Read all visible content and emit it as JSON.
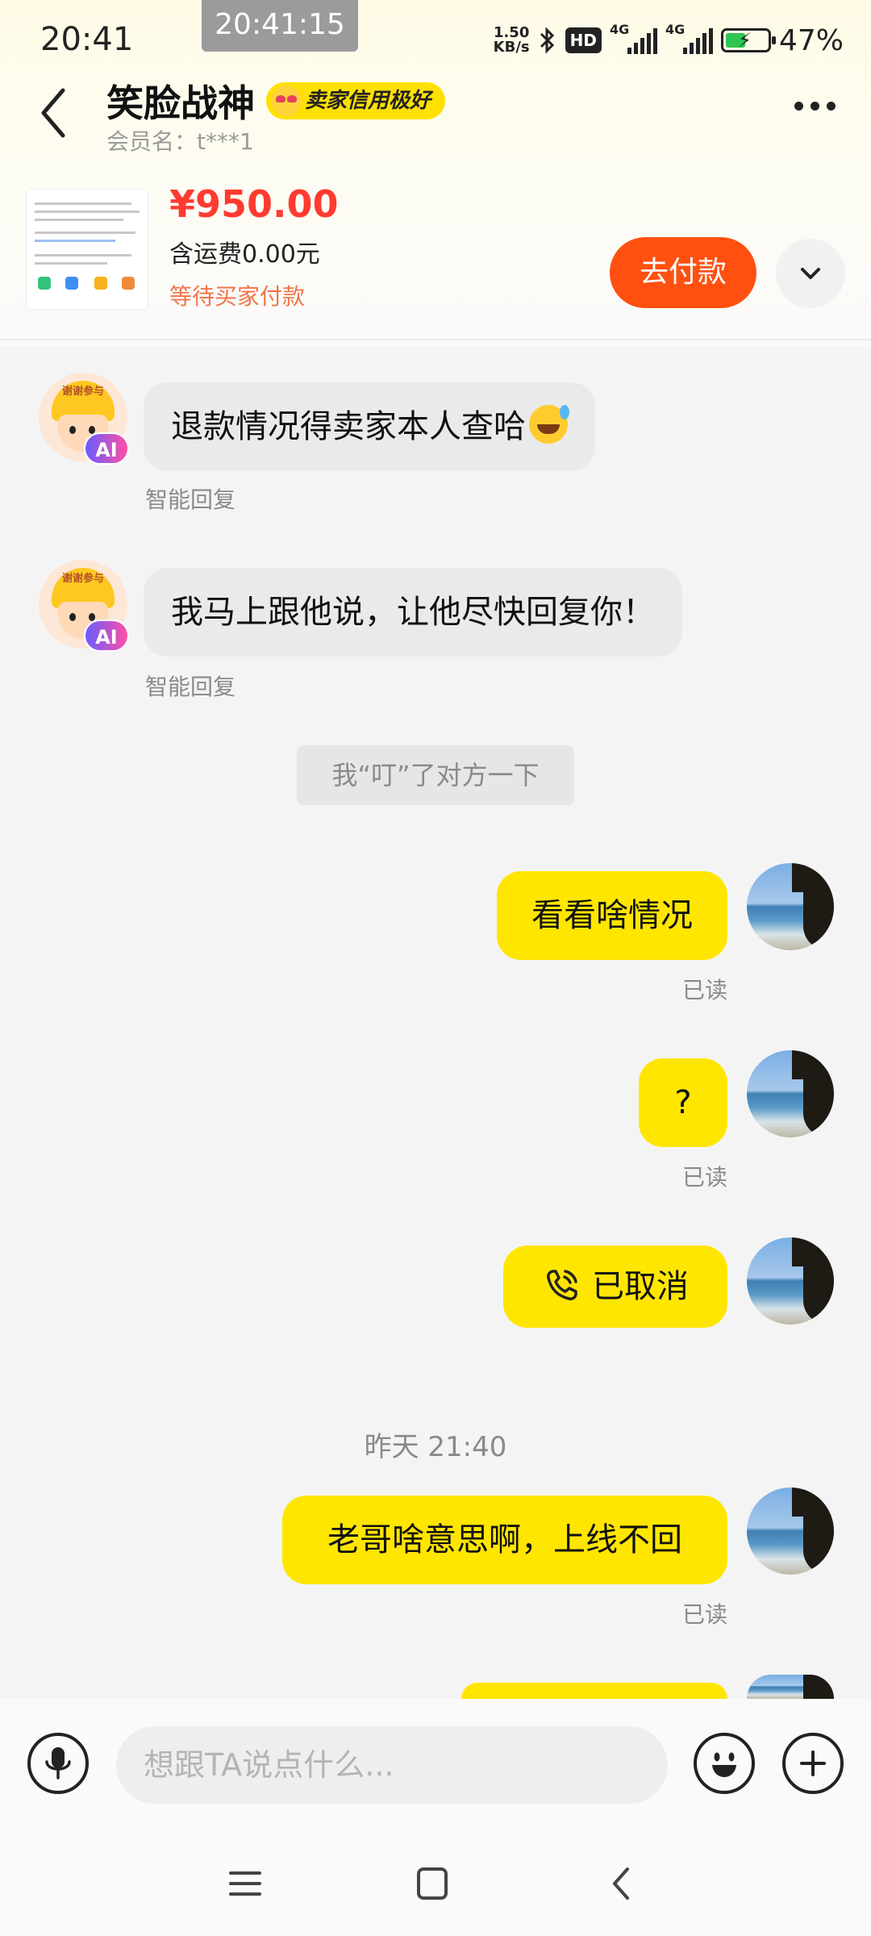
{
  "status_bar": {
    "time": "20:41",
    "overlay_time": "20:41:15",
    "net_speed_value": "1.50",
    "net_speed_unit": "KB/s",
    "hd_badge": "HD",
    "signal1_tag": "4G",
    "signal2_tag": "4G",
    "battery_percent": "47%",
    "battery_level": 0.47
  },
  "header": {
    "back_icon": "chevron-left-icon",
    "shop_name": "笑脸战神",
    "credit_badge": "卖家信用极好",
    "member_label": "会员名：t***1",
    "more_icon": "more-dots-icon"
  },
  "order": {
    "price": "¥950.00",
    "shipping": "含运费0.00元",
    "status": "等待买家付款",
    "pay_button": "去付款",
    "expand_icon": "chevron-down-icon"
  },
  "messages": {
    "m1": {
      "text": "退款情况得卖家本人查哈",
      "note": "智能回复",
      "avatar_badge": "AI",
      "avatar_text": "谢谢参与"
    },
    "m2": {
      "text": "我马上跟他说，让他尽快回复你！",
      "note": "智能回复",
      "avatar_badge": "AI",
      "avatar_text": "谢谢参与"
    },
    "system": "我“叮”了对方一下",
    "m3": {
      "text": "看看啥情况",
      "status": "已读"
    },
    "m4": {
      "text": "?",
      "status": "已读"
    },
    "m5": {
      "text": "已取消",
      "status": "",
      "icon": "phone-call-icon"
    },
    "time_divider": "昨天 21:40",
    "m6": {
      "text": "老哥啥意思啊，上线不回",
      "status": "已读"
    }
  },
  "input_bar": {
    "placeholder": "想跟TA说点什么...",
    "voice_icon": "microphone-icon",
    "emoji_icon": "emoji-icon",
    "plus_icon": "plus-icon"
  },
  "nav_bar": {
    "menu_icon": "menu-icon",
    "home_icon": "home-square-icon",
    "back_icon": "back-triangle-icon"
  },
  "colors": {
    "accent_yellow": "#ffe600",
    "price_red": "#ff3b30",
    "pay_orange": "#ff5010",
    "status_orange": "#f0764b"
  }
}
